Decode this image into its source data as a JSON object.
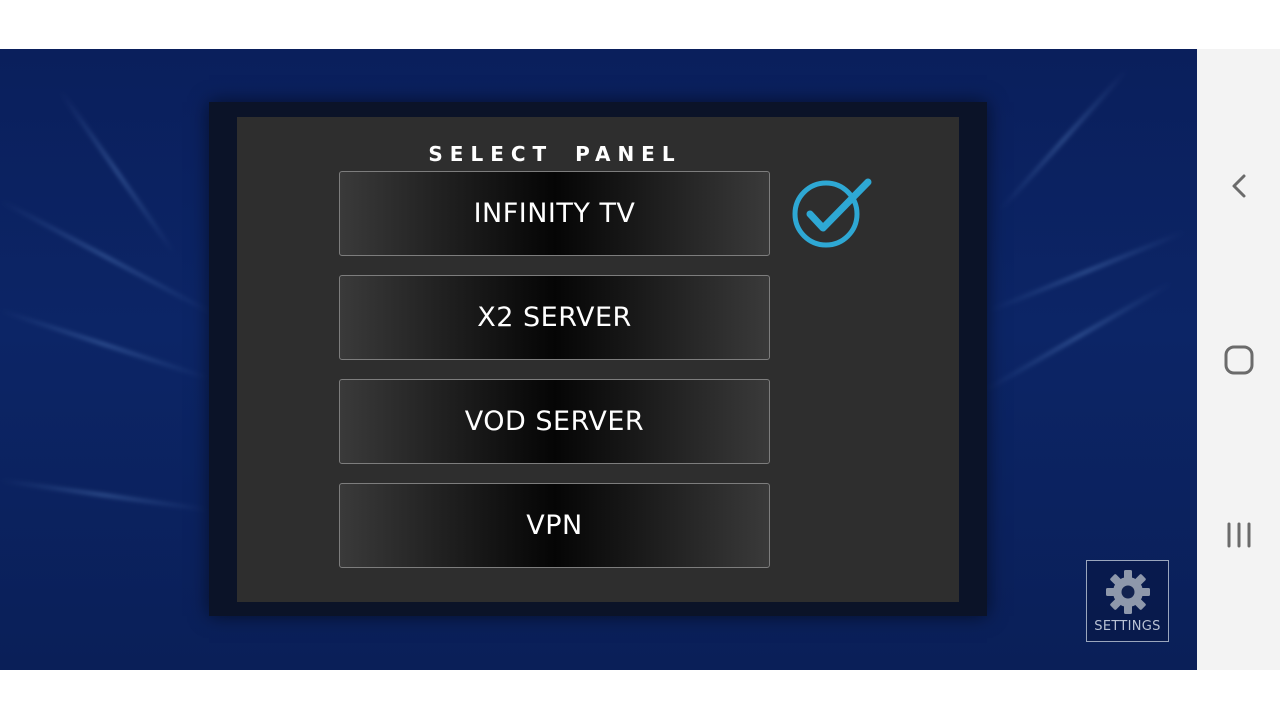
{
  "panel": {
    "title": "SELECT  PANEL",
    "options": [
      {
        "label": "INFINITY TV",
        "selected": true
      },
      {
        "label": "X2 SERVER",
        "selected": false
      },
      {
        "label": "VOD SERVER",
        "selected": false
      },
      {
        "label": "VPN",
        "selected": false
      }
    ]
  },
  "settings": {
    "label": "SETTINGS",
    "icon": "gear-icon"
  },
  "selected_indicator": {
    "icon": "checkmark-circle-icon",
    "color": "#2ea8d4"
  },
  "system_nav": {
    "back_icon": "back-chevron-icon",
    "home_icon": "home-icon",
    "recents_icon": "recents-icon"
  },
  "colors": {
    "background": "#0c2566",
    "panel": "#2e2e2e",
    "accent": "#2ea8d4"
  }
}
